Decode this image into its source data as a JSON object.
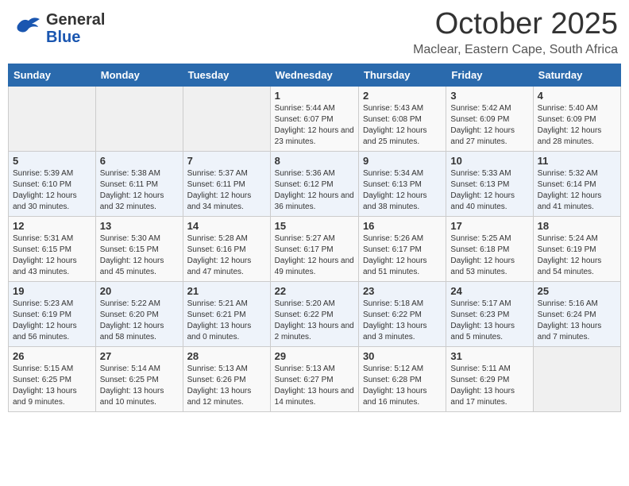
{
  "header": {
    "logo_general": "General",
    "logo_blue": "Blue",
    "month": "October 2025",
    "location": "Maclear, Eastern Cape, South Africa"
  },
  "weekdays": [
    "Sunday",
    "Monday",
    "Tuesday",
    "Wednesday",
    "Thursday",
    "Friday",
    "Saturday"
  ],
  "weeks": [
    [
      {
        "day": "",
        "info": ""
      },
      {
        "day": "",
        "info": ""
      },
      {
        "day": "",
        "info": ""
      },
      {
        "day": "1",
        "info": "Sunrise: 5:44 AM\nSunset: 6:07 PM\nDaylight: 12 hours and 23 minutes."
      },
      {
        "day": "2",
        "info": "Sunrise: 5:43 AM\nSunset: 6:08 PM\nDaylight: 12 hours and 25 minutes."
      },
      {
        "day": "3",
        "info": "Sunrise: 5:42 AM\nSunset: 6:09 PM\nDaylight: 12 hours and 27 minutes."
      },
      {
        "day": "4",
        "info": "Sunrise: 5:40 AM\nSunset: 6:09 PM\nDaylight: 12 hours and 28 minutes."
      }
    ],
    [
      {
        "day": "5",
        "info": "Sunrise: 5:39 AM\nSunset: 6:10 PM\nDaylight: 12 hours and 30 minutes."
      },
      {
        "day": "6",
        "info": "Sunrise: 5:38 AM\nSunset: 6:11 PM\nDaylight: 12 hours and 32 minutes."
      },
      {
        "day": "7",
        "info": "Sunrise: 5:37 AM\nSunset: 6:11 PM\nDaylight: 12 hours and 34 minutes."
      },
      {
        "day": "8",
        "info": "Sunrise: 5:36 AM\nSunset: 6:12 PM\nDaylight: 12 hours and 36 minutes."
      },
      {
        "day": "9",
        "info": "Sunrise: 5:34 AM\nSunset: 6:13 PM\nDaylight: 12 hours and 38 minutes."
      },
      {
        "day": "10",
        "info": "Sunrise: 5:33 AM\nSunset: 6:13 PM\nDaylight: 12 hours and 40 minutes."
      },
      {
        "day": "11",
        "info": "Sunrise: 5:32 AM\nSunset: 6:14 PM\nDaylight: 12 hours and 41 minutes."
      }
    ],
    [
      {
        "day": "12",
        "info": "Sunrise: 5:31 AM\nSunset: 6:15 PM\nDaylight: 12 hours and 43 minutes."
      },
      {
        "day": "13",
        "info": "Sunrise: 5:30 AM\nSunset: 6:15 PM\nDaylight: 12 hours and 45 minutes."
      },
      {
        "day": "14",
        "info": "Sunrise: 5:28 AM\nSunset: 6:16 PM\nDaylight: 12 hours and 47 minutes."
      },
      {
        "day": "15",
        "info": "Sunrise: 5:27 AM\nSunset: 6:17 PM\nDaylight: 12 hours and 49 minutes."
      },
      {
        "day": "16",
        "info": "Sunrise: 5:26 AM\nSunset: 6:17 PM\nDaylight: 12 hours and 51 minutes."
      },
      {
        "day": "17",
        "info": "Sunrise: 5:25 AM\nSunset: 6:18 PM\nDaylight: 12 hours and 53 minutes."
      },
      {
        "day": "18",
        "info": "Sunrise: 5:24 AM\nSunset: 6:19 PM\nDaylight: 12 hours and 54 minutes."
      }
    ],
    [
      {
        "day": "19",
        "info": "Sunrise: 5:23 AM\nSunset: 6:19 PM\nDaylight: 12 hours and 56 minutes."
      },
      {
        "day": "20",
        "info": "Sunrise: 5:22 AM\nSunset: 6:20 PM\nDaylight: 12 hours and 58 minutes."
      },
      {
        "day": "21",
        "info": "Sunrise: 5:21 AM\nSunset: 6:21 PM\nDaylight: 13 hours and 0 minutes."
      },
      {
        "day": "22",
        "info": "Sunrise: 5:20 AM\nSunset: 6:22 PM\nDaylight: 13 hours and 2 minutes."
      },
      {
        "day": "23",
        "info": "Sunrise: 5:18 AM\nSunset: 6:22 PM\nDaylight: 13 hours and 3 minutes."
      },
      {
        "day": "24",
        "info": "Sunrise: 5:17 AM\nSunset: 6:23 PM\nDaylight: 13 hours and 5 minutes."
      },
      {
        "day": "25",
        "info": "Sunrise: 5:16 AM\nSunset: 6:24 PM\nDaylight: 13 hours and 7 minutes."
      }
    ],
    [
      {
        "day": "26",
        "info": "Sunrise: 5:15 AM\nSunset: 6:25 PM\nDaylight: 13 hours and 9 minutes."
      },
      {
        "day": "27",
        "info": "Sunrise: 5:14 AM\nSunset: 6:25 PM\nDaylight: 13 hours and 10 minutes."
      },
      {
        "day": "28",
        "info": "Sunrise: 5:13 AM\nSunset: 6:26 PM\nDaylight: 13 hours and 12 minutes."
      },
      {
        "day": "29",
        "info": "Sunrise: 5:13 AM\nSunset: 6:27 PM\nDaylight: 13 hours and 14 minutes."
      },
      {
        "day": "30",
        "info": "Sunrise: 5:12 AM\nSunset: 6:28 PM\nDaylight: 13 hours and 16 minutes."
      },
      {
        "day": "31",
        "info": "Sunrise: 5:11 AM\nSunset: 6:29 PM\nDaylight: 13 hours and 17 minutes."
      },
      {
        "day": "",
        "info": ""
      }
    ]
  ]
}
